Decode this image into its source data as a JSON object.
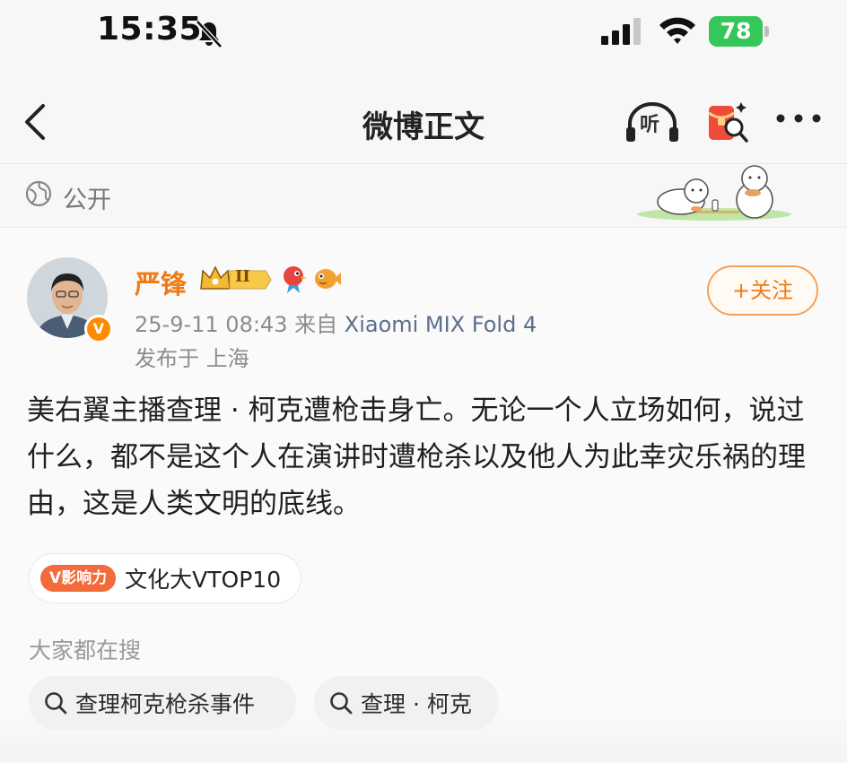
{
  "status_bar": {
    "time": "15:35",
    "battery": "78"
  },
  "nav": {
    "title": "微博正文",
    "listen_label": "听"
  },
  "visibility": {
    "label": "公开"
  },
  "post": {
    "author": {
      "name": "严锋",
      "level_badge": "II",
      "verified_mark": "V"
    },
    "meta": {
      "timestamp": "25-9-11 08:43",
      "source_prefix": "来自",
      "device": "Xiaomi MIX Fold 4",
      "location": "发布于 上海"
    },
    "follow_label": "+关注",
    "text": "美右翼主播查理 · 柯克遭枪击身亡。无论一个人立场如何，说过什么，都不是这个人在演讲时遭枪杀以及他人为此幸灾乐祸的理由，这是人类文明的底线。",
    "topic": {
      "badge": "V影响力",
      "label": "文化大VTOP10"
    },
    "search": {
      "heading": "大家都在搜",
      "items": [
        {
          "label": "查理柯克枪杀事件"
        },
        {
          "label": "查理 · 柯克"
        }
      ]
    }
  },
  "colors": {
    "accent_orange": "#f07a14",
    "battery_green": "#35c759",
    "device_link": "#5b6e8c"
  }
}
